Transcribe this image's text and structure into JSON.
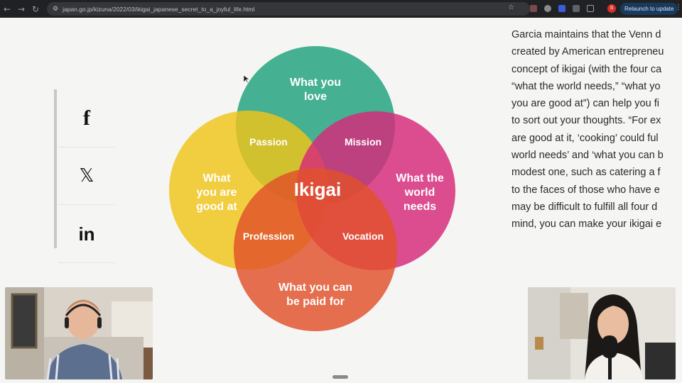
{
  "browser": {
    "url": "japan.go.jp/kizuna/2022/03/ikigai_japanese_secret_to_a_joyful_life.html",
    "profile_initial": "S",
    "relaunch_label": "Relaunch to update",
    "icons": [
      "back-icon",
      "forward-icon",
      "reload-icon",
      "site-settings-icon",
      "star-icon",
      "menu-icon"
    ]
  },
  "share": {
    "facebook": "f",
    "x": "𝕏",
    "linkedin": "in"
  },
  "venn": {
    "love": [
      "What you",
      "love"
    ],
    "good_at": [
      "What",
      "you are",
      "good at"
    ],
    "world_needs": [
      "What the",
      "world",
      "needs"
    ],
    "paid_for": [
      "What you can",
      "be paid for"
    ],
    "passion": "Passion",
    "mission": "Mission",
    "profession": "Profession",
    "vocation": "Vocation",
    "center": "Ikigai",
    "colors": {
      "love": "#1fa27c",
      "good_at": "#f0c419",
      "world_needs": "#d7287a",
      "paid_for": "#e0502a"
    }
  },
  "article": {
    "lines": [
      "Garcia maintains that the Venn d",
      "created by American entrepreneu",
      "concept of ikigai (with the four ca",
      "“what the world needs,” “what yo",
      "you are good at”) can help you fi",
      "to sort out your thoughts. “For ex",
      "are good at it, ‘cooking’ could ful",
      "world needs’ and ‘what you can b",
      "modest one, such as catering a f",
      "to the faces of those who have e",
      "may be difficult to fulfill all four d",
      "mind, you can make your ikigai e"
    ]
  }
}
